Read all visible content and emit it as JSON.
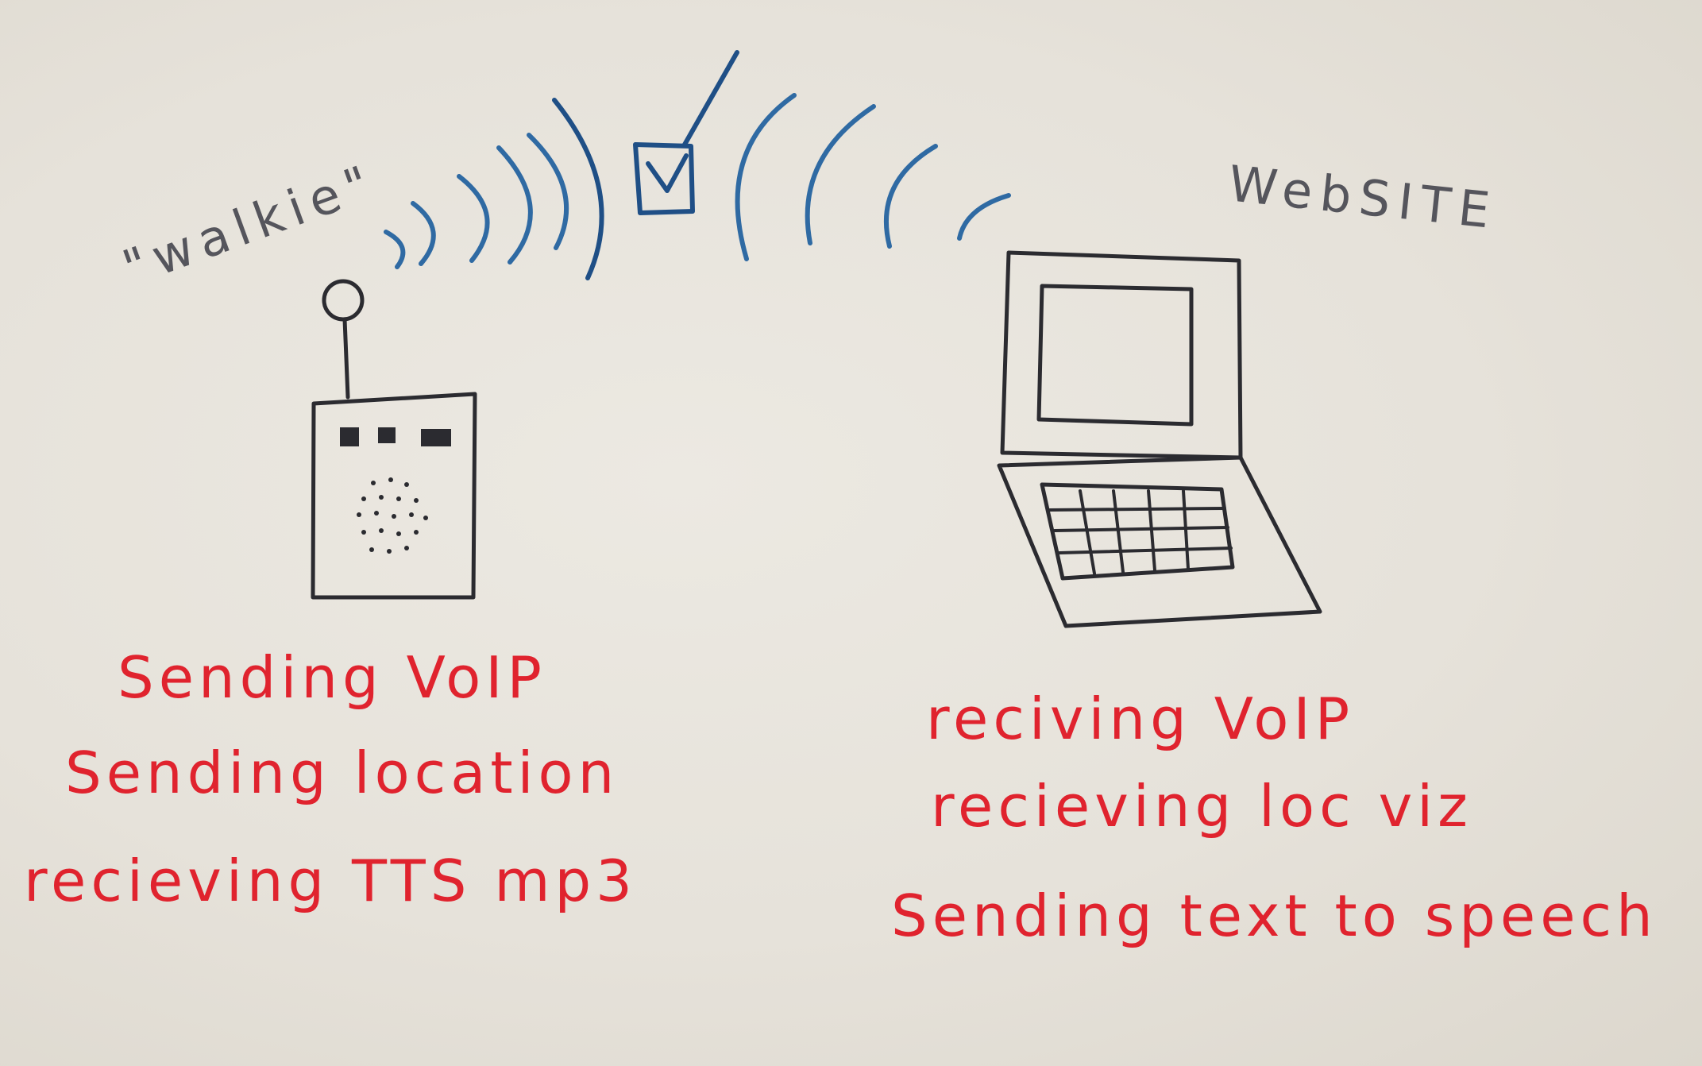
{
  "walkie": {
    "label": "\"walkie\"",
    "lines": [
      "Sending VoIP",
      "Sending location",
      "recieving TTS mp3"
    ]
  },
  "website": {
    "label": "WebSITE",
    "lines": [
      "reciving VoIP",
      "recieving loc viz",
      "Sending text to speech"
    ]
  },
  "colors": {
    "paper": "#e6e2da",
    "black_ink": "#2b2b30",
    "blue_ink": "#2f6aa3",
    "red_ink": "#e0232e"
  }
}
